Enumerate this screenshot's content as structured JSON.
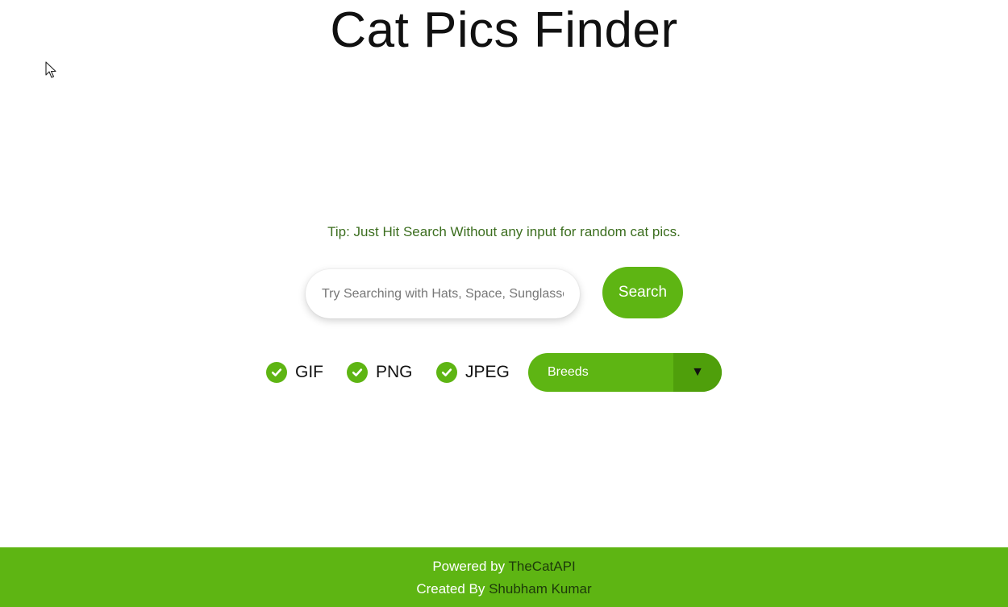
{
  "header": {
    "title": "Cat Pics Finder"
  },
  "tip": "Tip: Just Hit Search Without any input for random cat pics.",
  "search": {
    "placeholder": "Try Searching with Hats, Space, Sunglasses",
    "value": "",
    "button_label": "Search"
  },
  "filters": {
    "options": [
      {
        "label": "GIF",
        "checked": true
      },
      {
        "label": "PNG",
        "checked": true
      },
      {
        "label": "JPEG",
        "checked": true
      }
    ],
    "breeds": {
      "selected": "Breeds",
      "arrow": "▼"
    }
  },
  "footer": {
    "powered_prefix": "Powered by ",
    "powered_link": "TheCatAPI",
    "created_prefix": "Created By ",
    "created_link": "Shubham Kumar"
  },
  "colors": {
    "accent": "#5eb513",
    "accent_dark": "#4f9f0b",
    "tip_text": "#3c6e1f",
    "footer_link": "#1d3a0a"
  },
  "icons": {
    "check": "check-circle-icon",
    "cursor": "mouse-cursor-icon",
    "dropdown": "triangle-down-icon"
  }
}
